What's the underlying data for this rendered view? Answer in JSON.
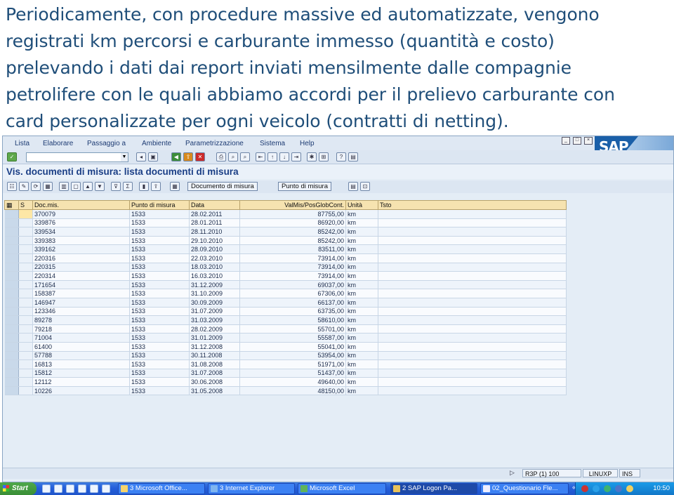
{
  "slide": {
    "lines": [
      "Periodicamente, con procedure massive ed automatizzate, vengono",
      "registrati km percorsi e carburante immesso (quantità e costo)",
      "prelevando i dati dai report inviati mensilmente dalle compagnie",
      "petrolifere con le quali abbiamo accordi per il prelievo carburante con",
      "card personalizzate per ogni veicolo (contratti di netting)."
    ]
  },
  "sap": {
    "menu": [
      "Lista",
      "Elaborare",
      "Passaggio a",
      "Ambiente",
      "Parametrizzazione",
      "Sistema",
      "Help"
    ],
    "logo_text": "SAP",
    "screen_title": "Vis. documenti di misura: lista documenti di misura",
    "toolbar2_buttons": [
      "Documento di misura",
      "Punto di misura"
    ],
    "table": {
      "headers": [
        "S",
        "Doc.mis.",
        "Punto di misura",
        "Data",
        "ValMis/PosGlobCont.",
        "Unità",
        "Tsto"
      ],
      "rows": [
        [
          "370079",
          "1533",
          "28.02.2011",
          "87755,00",
          "km"
        ],
        [
          "339876",
          "1533",
          "28.01.2011",
          "86920,00",
          "km"
        ],
        [
          "339534",
          "1533",
          "28.11.2010",
          "85242,00",
          "km"
        ],
        [
          "339383",
          "1533",
          "29.10.2010",
          "85242,00",
          "km"
        ],
        [
          "339162",
          "1533",
          "28.09.2010",
          "83511,00",
          "km"
        ],
        [
          "220316",
          "1533",
          "22.03.2010",
          "73914,00",
          "km"
        ],
        [
          "220315",
          "1533",
          "18.03.2010",
          "73914,00",
          "km"
        ],
        [
          "220314",
          "1533",
          "16.03.2010",
          "73914,00",
          "km"
        ],
        [
          "171654",
          "1533",
          "31.12.2009",
          "69037,00",
          "km"
        ],
        [
          "158387",
          "1533",
          "31.10.2009",
          "67306,00",
          "km"
        ],
        [
          "146947",
          "1533",
          "30.09.2009",
          "66137,00",
          "km"
        ],
        [
          "123346",
          "1533",
          "31.07.2009",
          "63735,00",
          "km"
        ],
        [
          "89278",
          "1533",
          "31.03.2009",
          "58610,00",
          "km"
        ],
        [
          "79218",
          "1533",
          "28.02.2009",
          "55701,00",
          "km"
        ],
        [
          "71004",
          "1533",
          "31.01.2009",
          "55587,00",
          "km"
        ],
        [
          "61400",
          "1533",
          "31.12.2008",
          "55041,00",
          "km"
        ],
        [
          "57788",
          "1533",
          "30.11.2008",
          "53954,00",
          "km"
        ],
        [
          "16813",
          "1533",
          "31.08.2008",
          "51971,00",
          "km"
        ],
        [
          "15812",
          "1533",
          "31.07.2008",
          "51437,00",
          "km"
        ],
        [
          "12112",
          "1533",
          "30.06.2008",
          "49640,00",
          "km"
        ],
        [
          "10226",
          "1533",
          "31.05.2008",
          "48150,00",
          "km"
        ]
      ]
    },
    "status": {
      "system": "R3P (1) 100",
      "server": "LINUXP",
      "mode": "INS"
    }
  },
  "taskbar": {
    "start_label": "Start",
    "tasks": [
      "3 Microsoft Office...",
      "3 Internet Explorer",
      "Microsoft Excel",
      "2 SAP Logon Pa...",
      "02_Questionario Fle..."
    ],
    "clock": "10:50"
  }
}
